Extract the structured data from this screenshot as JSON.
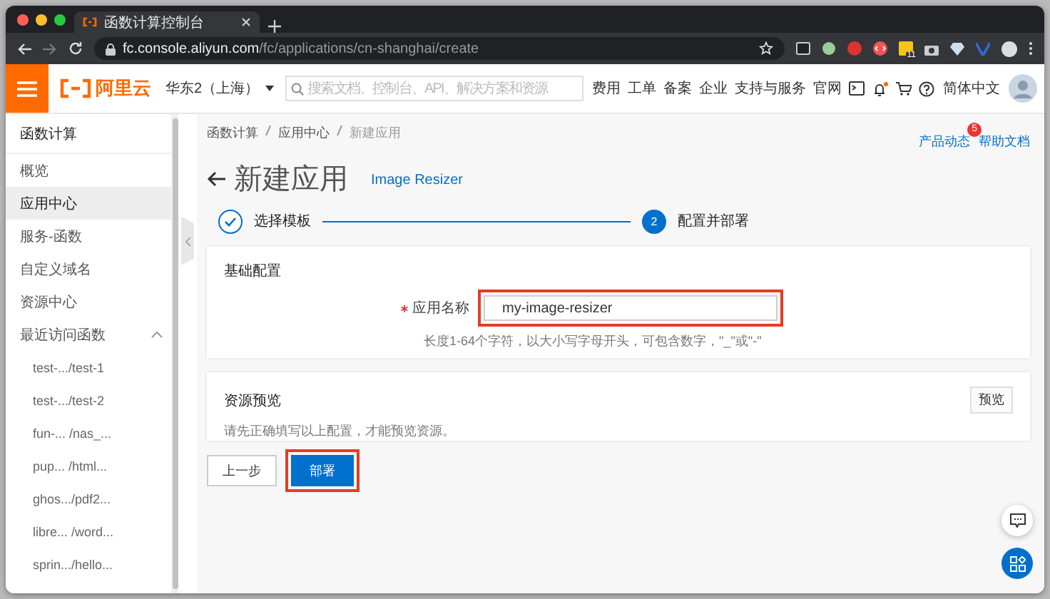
{
  "browser": {
    "tab_title": "函数计算控制台",
    "url_host": "fc.console.aliyun.com",
    "url_path": "/fc/applications/cn-shanghai/create",
    "extension_badge": "11"
  },
  "header": {
    "brand": "阿里云",
    "region": "华东2（上海）",
    "search": {
      "placeholder": "搜索文档、控制台、API、解决方案和资源"
    },
    "nav": [
      "费用",
      "工单",
      "备案",
      "企业",
      "支持与服务",
      "官网"
    ],
    "language": "简体中文"
  },
  "sidebar": {
    "title": "函数计算",
    "items": [
      {
        "label": "概览",
        "selected": false
      },
      {
        "label": "应用中心",
        "selected": true
      },
      {
        "label": "服务-函数",
        "selected": false
      },
      {
        "label": "自定义域名",
        "selected": false
      },
      {
        "label": "资源中心",
        "selected": false
      },
      {
        "label": "最近访问函数",
        "selected": false,
        "expanded": true,
        "children": [
          {
            "label": "test-.../test-1"
          },
          {
            "label": "test-.../test-2"
          },
          {
            "label": "fun-... /nas_..."
          },
          {
            "label": "pup... /html..."
          },
          {
            "label": "ghos.../pdf2..."
          },
          {
            "label": "libre... /word..."
          },
          {
            "label": "sprin.../hello..."
          }
        ]
      }
    ]
  },
  "breadcrumb": [
    "函数计算",
    "应用中心",
    "新建应用"
  ],
  "top_links": [
    {
      "label": "产品动态",
      "badge": "5"
    },
    {
      "label": "帮助文档"
    }
  ],
  "page": {
    "title": "新建应用",
    "template": "Image Resizer"
  },
  "steps": [
    {
      "label": "选择模板",
      "completed": true
    },
    {
      "number": "2",
      "label": "配置并部署",
      "completed": false
    }
  ],
  "basic_config": {
    "title": "基础配置",
    "field": {
      "label": "应用名称",
      "required": true,
      "value": "my-image-resizer",
      "highlighted": true,
      "hint": "长度1-64个字符，以大小写字母开头，可包含数字，\"_\"或\"-\""
    }
  },
  "resource_preview": {
    "title": "资源预览",
    "button": "预览",
    "note": "请先正确填写以上配置，才能预览资源。"
  },
  "actions": [
    {
      "label": "上一步",
      "kind": "secondary",
      "highlighted": false
    },
    {
      "label": "部署",
      "kind": "primary",
      "highlighted": true
    }
  ]
}
